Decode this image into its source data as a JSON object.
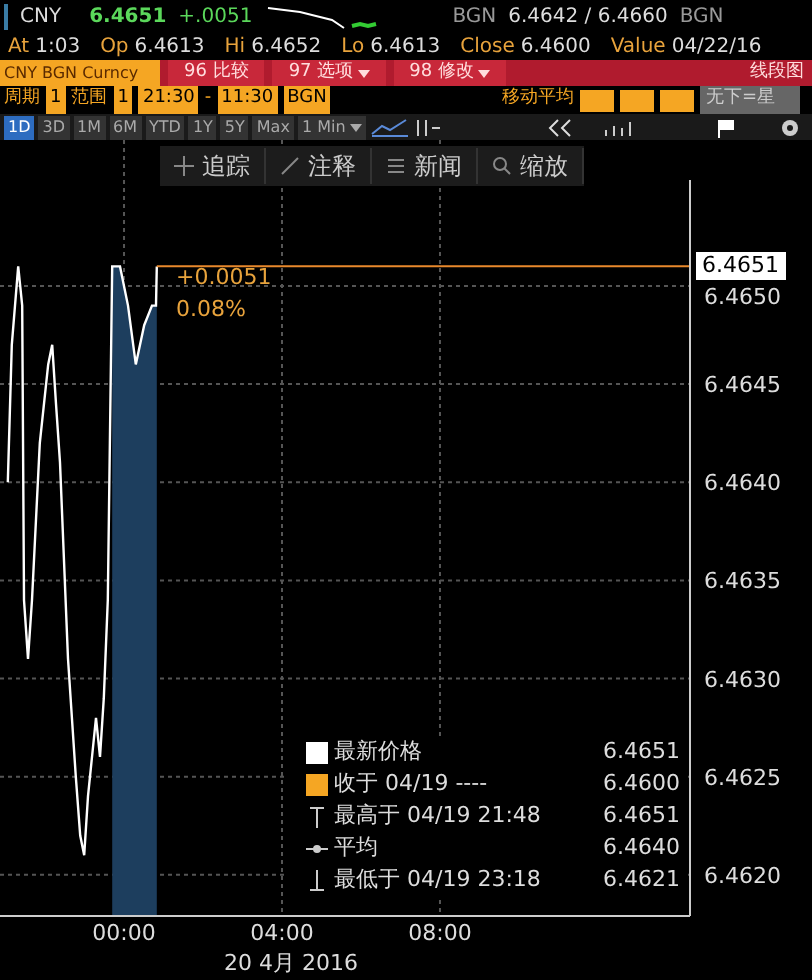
{
  "quote": {
    "ticker": "CNY",
    "last": "6.4651",
    "change": "+.0051",
    "source": "BGN",
    "bid_ask": "6.4642 / 6.4660",
    "source_right": "BGN"
  },
  "stats": [
    {
      "label": "At",
      "value": "1:03"
    },
    {
      "label": "Op",
      "value": "6.4613"
    },
    {
      "label": "Hi",
      "value": "6.4652"
    },
    {
      "label": "Lo",
      "value": "6.4613"
    },
    {
      "label": "Close",
      "value": "6.4600"
    },
    {
      "label": "Value",
      "value": "04/22/16"
    }
  ],
  "menu": {
    "security": "CNY BGN Curncy",
    "buttons": [
      {
        "label": "96 比较",
        "dropdown": false
      },
      {
        "label": "97 选项",
        "dropdown": true
      },
      {
        "label": "98 修改",
        "dropdown": true
      }
    ],
    "chart_type": "线段图"
  },
  "settings": {
    "period_label": "周期",
    "period": "1",
    "range_label": "范围",
    "range": "1",
    "start": "21:30",
    "dash": "-",
    "end": "11:30",
    "source": "BGN",
    "ma_label": "移动平均",
    "no_event": "无下=星"
  },
  "ranges": [
    {
      "label": "1D",
      "selected": true
    },
    {
      "label": "3D",
      "selected": false
    },
    {
      "label": "1M",
      "selected": false
    },
    {
      "label": "6M",
      "selected": false
    },
    {
      "label": "YTD",
      "selected": false
    },
    {
      "label": "1Y",
      "selected": false
    },
    {
      "label": "5Y",
      "selected": false
    },
    {
      "label": "Max",
      "selected": false
    }
  ],
  "interval": "1 Min",
  "tools": [
    {
      "label": "追踪",
      "kind": "track"
    },
    {
      "label": "注释",
      "kind": "annotate"
    },
    {
      "label": "新闻",
      "kind": "news"
    },
    {
      "label": "缩放",
      "kind": "zoom"
    }
  ],
  "chart": {
    "current_price": "6.4651",
    "change_label": "+0.0051",
    "change_pct": "0.08%",
    "date_label": "20 4月 2016",
    "chart_data": {
      "type": "line",
      "grid": true,
      "bands": [
        {
          "axis": "x",
          "from": -0.3,
          "to": 0.83,
          "color": "#1d3e5e"
        }
      ],
      "xlim": [
        -3.14,
        14.33
      ],
      "ylim": [
        6.46179,
        6.46554
      ],
      "xticks": [
        {
          "value": 0,
          "label": "00:00"
        },
        {
          "value": 4,
          "label": "04:00"
        },
        {
          "value": 8,
          "label": "08:00"
        }
      ],
      "yticks": [
        {
          "value": 6.465,
          "label": "6.4650"
        },
        {
          "value": 6.4645,
          "label": "6.4645"
        },
        {
          "value": 6.464,
          "label": "6.4640"
        },
        {
          "value": 6.4635,
          "label": "6.4635"
        },
        {
          "value": 6.463,
          "label": "6.4630"
        },
        {
          "value": 6.4625,
          "label": "6.4625"
        },
        {
          "value": 6.462,
          "label": "6.4620"
        }
      ],
      "x": [
        -2.94,
        -2.84,
        -2.68,
        -2.58,
        -2.53,
        -2.43,
        -2.33,
        -2.13,
        -1.92,
        -1.82,
        -1.72,
        -1.62,
        -1.42,
        -1.22,
        -1.11,
        -1.01,
        -0.91,
        -0.81,
        -0.71,
        -0.61,
        -0.51,
        -0.41,
        -0.3,
        -0.1,
        0.1,
        0.3,
        0.51,
        0.71,
        0.81,
        0.83
      ],
      "series": [
        {
          "name": "最新价格",
          "color": "#ffffff",
          "values": [
            6.464,
            6.4647,
            6.4651,
            6.4649,
            6.4634,
            6.4631,
            6.4634,
            6.4642,
            6.4646,
            6.4647,
            6.4644,
            6.4641,
            6.4631,
            6.4625,
            6.4622,
            6.4621,
            6.4624,
            6.4626,
            6.4628,
            6.4626,
            6.4629,
            6.4634,
            6.4651,
            6.4651,
            6.4649,
            6.4646,
            6.4648,
            6.4649,
            6.4649,
            6.4651
          ]
        }
      ]
    },
    "legend": [
      {
        "kind": "last",
        "value": "6.4651",
        "color": "#ffffff"
      },
      {
        "kind": "close",
        "label": "收于 04/19 ----",
        "value": "6.4600",
        "color": "#f5a623"
      },
      {
        "kind": "high",
        "label": "最高于 04/19 21:48",
        "value": "6.4651"
      },
      {
        "kind": "avg",
        "label": "平均",
        "value": "6.4640"
      },
      {
        "kind": "low",
        "label": "最低于 04/19 23:18",
        "value": "6.4621"
      }
    ]
  }
}
